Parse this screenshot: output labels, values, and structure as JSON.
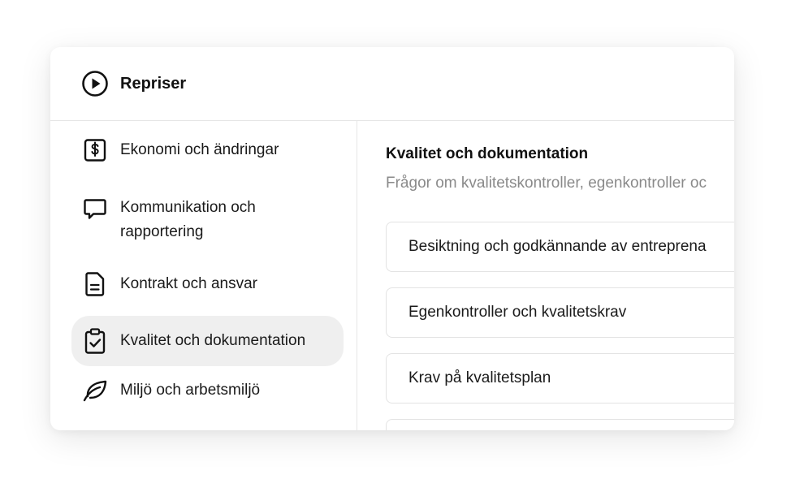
{
  "header": {
    "icon": "play-circle-icon",
    "title": "Repriser"
  },
  "sidebar": {
    "items": [
      {
        "label": "Ekonomi och ändringar",
        "icon": "dollar-document-icon"
      },
      {
        "label": "Kommunikation och rapportering",
        "icon": "chat-bubble-icon"
      },
      {
        "label": "Kontrakt och ansvar",
        "icon": "document-icon"
      },
      {
        "label": "Kvalitet och dokumentation",
        "icon": "clipboard-check-icon",
        "active": true
      },
      {
        "label": "Miljö och arbetsmiljö",
        "icon": "leaf-icon"
      }
    ]
  },
  "main": {
    "title": "Kvalitet och dokumentation",
    "description": "Frågor om kvalitetskontroller, egenkontroller oc",
    "questions": [
      "Besiktning och godkännande av entreprena",
      "Egenkontroller och kvalitetskrav",
      "Krav på kvalitetsplan",
      ""
    ]
  }
}
